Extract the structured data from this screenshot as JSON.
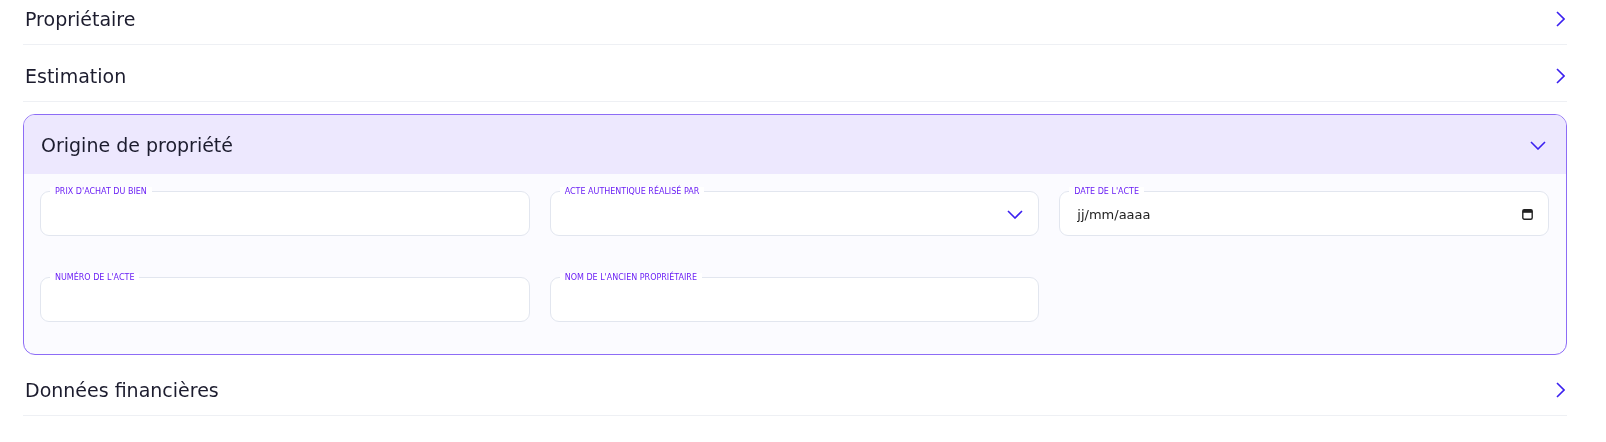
{
  "sections": [
    {
      "title": "Propriétaire",
      "expanded": false
    },
    {
      "title": "Estimation",
      "expanded": false
    },
    {
      "title": "Origine de propriété",
      "expanded": true,
      "fields": [
        {
          "kind": "text",
          "label": "PRIX D'ACHAT DU BIEN"
        },
        {
          "kind": "select",
          "label": "ACTE AUTHENTIQUE RÉALISÉ PAR"
        },
        {
          "kind": "date",
          "label": "DATE DE L'ACTE",
          "placeholder": "jj/mm/aaaa"
        },
        {
          "kind": "text",
          "label": "NUMÉRO DE L'ACTE"
        },
        {
          "kind": "text",
          "label": "NOM DE L'ANCIEN PROPRIÉTAIRE"
        }
      ]
    },
    {
      "title": "Données financières",
      "expanded": false
    }
  ]
}
